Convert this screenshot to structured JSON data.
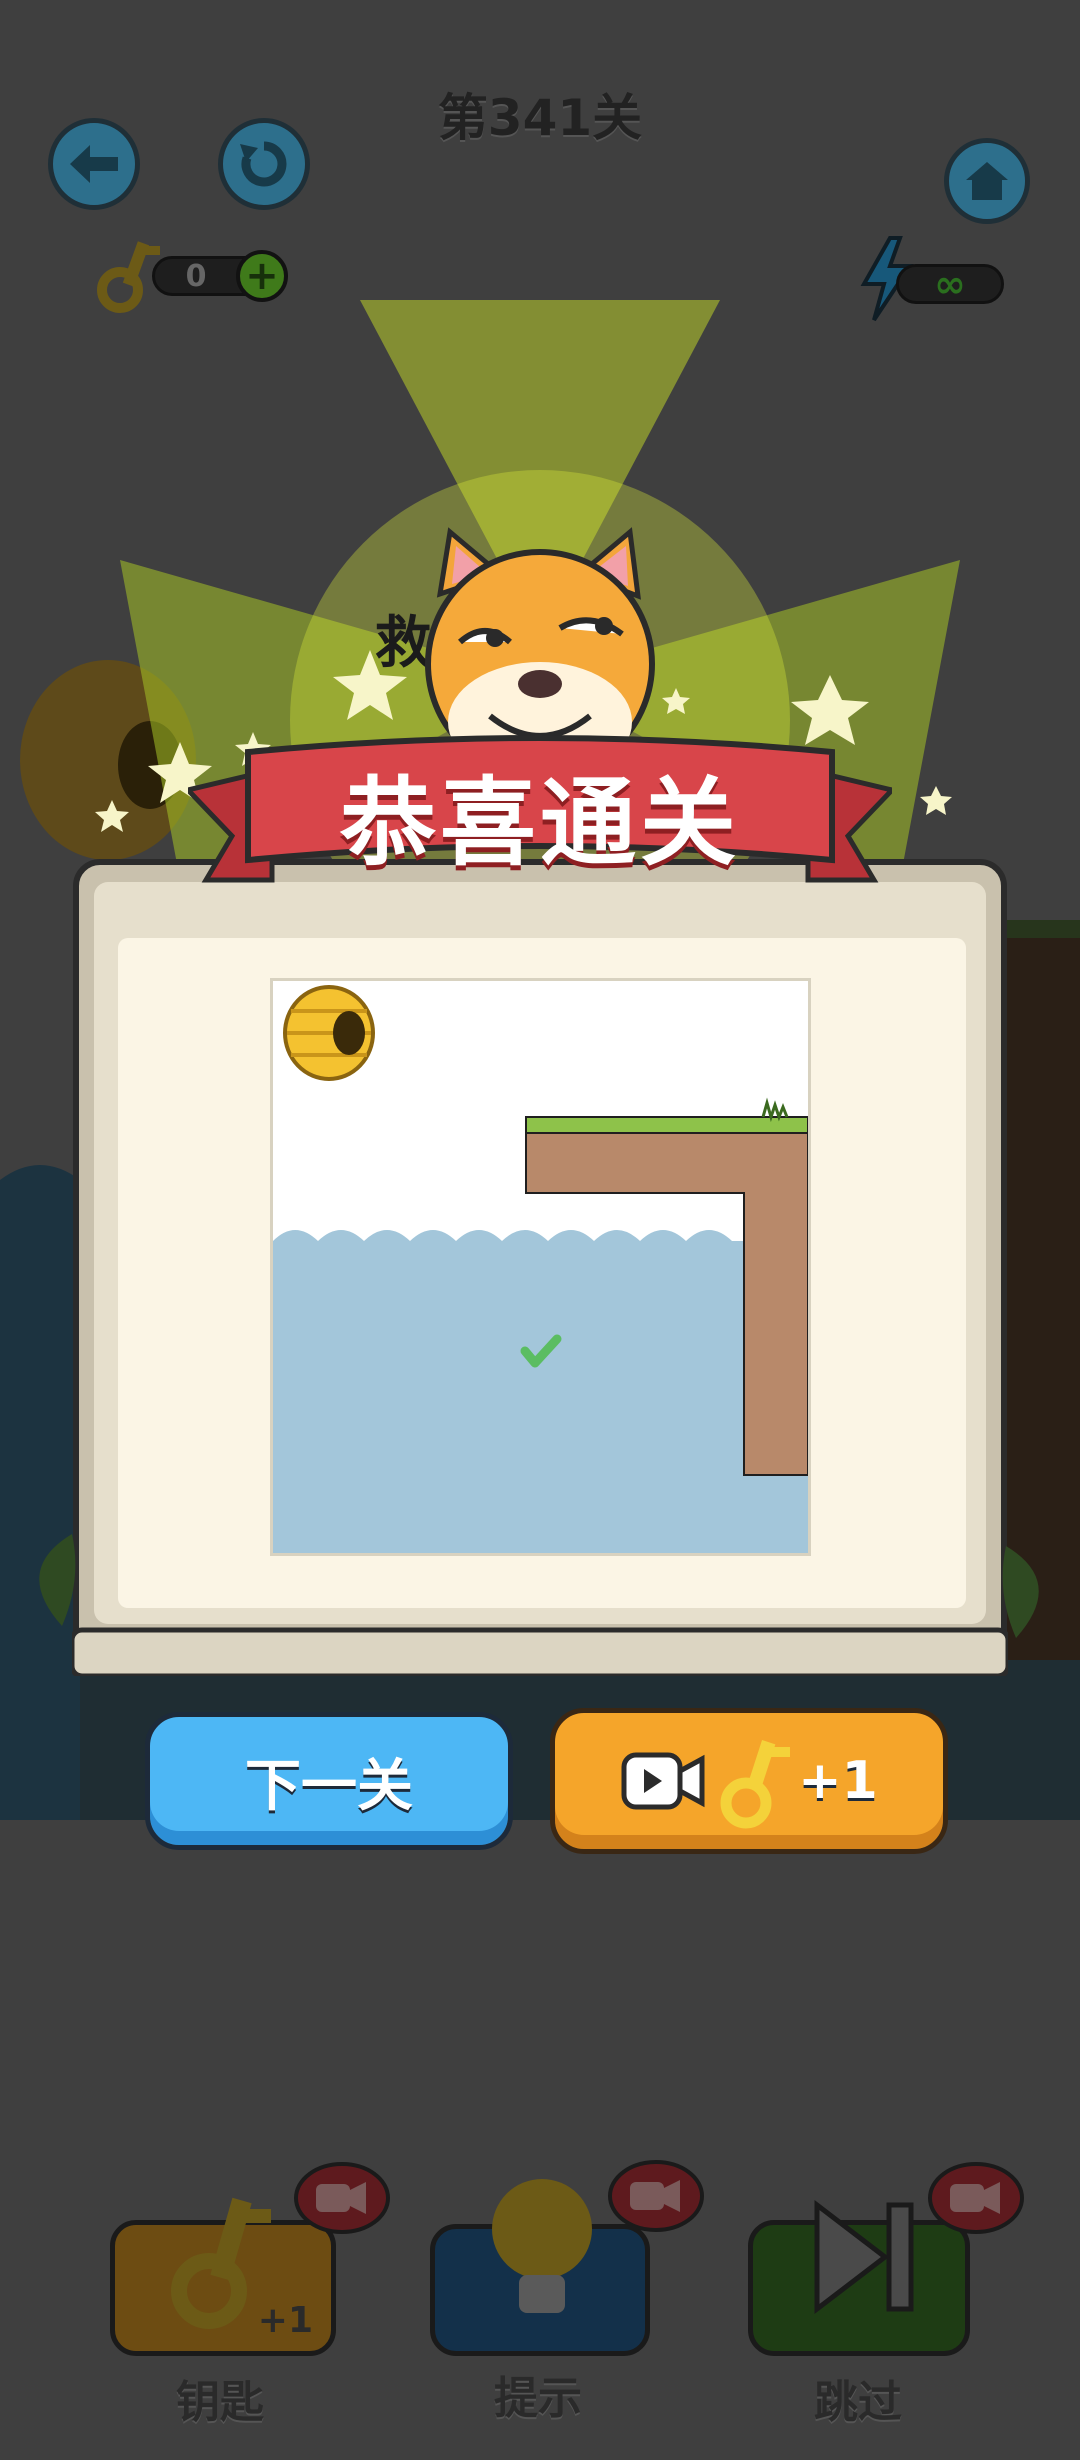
{
  "header": {
    "level_title": "第341关",
    "keys_count": "0",
    "energy": "∞"
  },
  "popup": {
    "title": "恭喜通关"
  },
  "actions": {
    "next_label": "下一关",
    "video_reward_label": "+1"
  },
  "bottom_bar": {
    "items": [
      {
        "label": "钥匙",
        "badge": "+1"
      },
      {
        "label": "提示"
      },
      {
        "label": "跳过"
      }
    ]
  },
  "background_fragment": "救",
  "colors": {
    "overlay": "#3f3f3f",
    "ribbon": "#d8454a",
    "next_button": "#4db7f5",
    "video_button": "#f5a52a",
    "water": "#a3c6da",
    "dirt": "#b8896a",
    "grass": "#8ec24a"
  }
}
